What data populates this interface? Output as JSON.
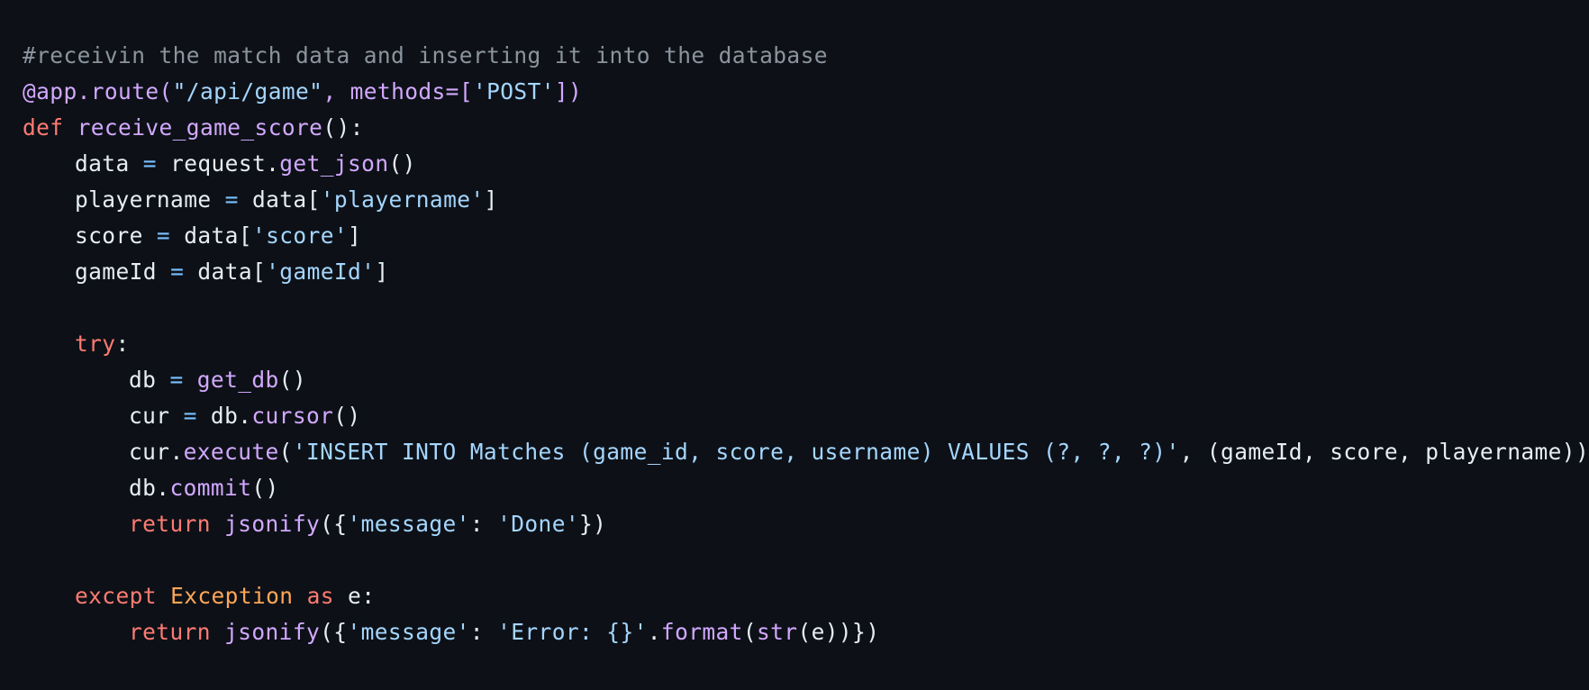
{
  "colors": {
    "background": "#0d1117",
    "default": "#e6edf3",
    "comment": "#8b949e",
    "keyword": "#ff7b72",
    "function": "#d2a8ff",
    "string": "#a5d6ff",
    "operator": "#79c0ff",
    "class": "#ffa657"
  },
  "code": {
    "language": "python",
    "lines": [
      {
        "indent": 0,
        "tokens": [
          {
            "t": "comment",
            "v": "#receivin the match data and inserting it into the database"
          }
        ]
      },
      {
        "indent": 0,
        "tokens": [
          {
            "t": "func",
            "v": "@app.route("
          },
          {
            "t": "string",
            "v": "\"/api/game\""
          },
          {
            "t": "func",
            "v": ", methods=["
          },
          {
            "t": "string",
            "v": "'POST'"
          },
          {
            "t": "func",
            "v": "])"
          }
        ]
      },
      {
        "indent": 0,
        "tokens": [
          {
            "t": "keyword",
            "v": "def"
          },
          {
            "t": "default",
            "v": " "
          },
          {
            "t": "func",
            "v": "receive_game_score"
          },
          {
            "t": "default",
            "v": "():"
          }
        ]
      },
      {
        "indent": 1,
        "tokens": [
          {
            "t": "default",
            "v": "data "
          },
          {
            "t": "op",
            "v": "="
          },
          {
            "t": "default",
            "v": " request."
          },
          {
            "t": "func",
            "v": "get_json"
          },
          {
            "t": "default",
            "v": "()"
          }
        ]
      },
      {
        "indent": 1,
        "tokens": [
          {
            "t": "default",
            "v": "playername "
          },
          {
            "t": "op",
            "v": "="
          },
          {
            "t": "default",
            "v": " data["
          },
          {
            "t": "string",
            "v": "'playername'"
          },
          {
            "t": "default",
            "v": "]"
          }
        ]
      },
      {
        "indent": 1,
        "tokens": [
          {
            "t": "default",
            "v": "score "
          },
          {
            "t": "op",
            "v": "="
          },
          {
            "t": "default",
            "v": " data["
          },
          {
            "t": "string",
            "v": "'score'"
          },
          {
            "t": "default",
            "v": "]"
          }
        ]
      },
      {
        "indent": 1,
        "tokens": [
          {
            "t": "default",
            "v": "gameId "
          },
          {
            "t": "op",
            "v": "="
          },
          {
            "t": "default",
            "v": " data["
          },
          {
            "t": "string",
            "v": "'gameId'"
          },
          {
            "t": "default",
            "v": "]"
          }
        ]
      },
      {
        "indent": 0,
        "tokens": []
      },
      {
        "indent": 1,
        "tokens": [
          {
            "t": "keyword",
            "v": "try"
          },
          {
            "t": "default",
            "v": ":"
          }
        ]
      },
      {
        "indent": 2,
        "tokens": [
          {
            "t": "default",
            "v": "db "
          },
          {
            "t": "op",
            "v": "="
          },
          {
            "t": "default",
            "v": " "
          },
          {
            "t": "func",
            "v": "get_db"
          },
          {
            "t": "default",
            "v": "()"
          }
        ]
      },
      {
        "indent": 2,
        "tokens": [
          {
            "t": "default",
            "v": "cur "
          },
          {
            "t": "op",
            "v": "="
          },
          {
            "t": "default",
            "v": " db."
          },
          {
            "t": "func",
            "v": "cursor"
          },
          {
            "t": "default",
            "v": "()"
          }
        ]
      },
      {
        "indent": 2,
        "tokens": [
          {
            "t": "default",
            "v": "cur."
          },
          {
            "t": "func",
            "v": "execute"
          },
          {
            "t": "default",
            "v": "("
          },
          {
            "t": "string",
            "v": "'INSERT INTO Matches (game_id, score, username) VALUES (?, ?, ?)'"
          },
          {
            "t": "default",
            "v": ", (gameId, score, playername))"
          }
        ]
      },
      {
        "indent": 2,
        "tokens": [
          {
            "t": "default",
            "v": "db."
          },
          {
            "t": "func",
            "v": "commit"
          },
          {
            "t": "default",
            "v": "()"
          }
        ]
      },
      {
        "indent": 2,
        "tokens": [
          {
            "t": "keyword",
            "v": "return"
          },
          {
            "t": "default",
            "v": " "
          },
          {
            "t": "func",
            "v": "jsonify"
          },
          {
            "t": "default",
            "v": "({"
          },
          {
            "t": "string",
            "v": "'message'"
          },
          {
            "t": "default",
            "v": ": "
          },
          {
            "t": "string",
            "v": "'Done'"
          },
          {
            "t": "default",
            "v": "})"
          }
        ]
      },
      {
        "indent": 0,
        "tokens": []
      },
      {
        "indent": 1,
        "tokens": [
          {
            "t": "keyword",
            "v": "except"
          },
          {
            "t": "default",
            "v": " "
          },
          {
            "t": "class",
            "v": "Exception"
          },
          {
            "t": "default",
            "v": " "
          },
          {
            "t": "keyword",
            "v": "as"
          },
          {
            "t": "default",
            "v": " e:"
          }
        ]
      },
      {
        "indent": 2,
        "tokens": [
          {
            "t": "keyword",
            "v": "return"
          },
          {
            "t": "default",
            "v": " "
          },
          {
            "t": "func",
            "v": "jsonify"
          },
          {
            "t": "default",
            "v": "({"
          },
          {
            "t": "string",
            "v": "'message'"
          },
          {
            "t": "default",
            "v": ": "
          },
          {
            "t": "string",
            "v": "'Error: {}'"
          },
          {
            "t": "default",
            "v": "."
          },
          {
            "t": "func",
            "v": "format"
          },
          {
            "t": "default",
            "v": "("
          },
          {
            "t": "func",
            "v": "str"
          },
          {
            "t": "default",
            "v": "(e))})"
          }
        ]
      }
    ]
  }
}
